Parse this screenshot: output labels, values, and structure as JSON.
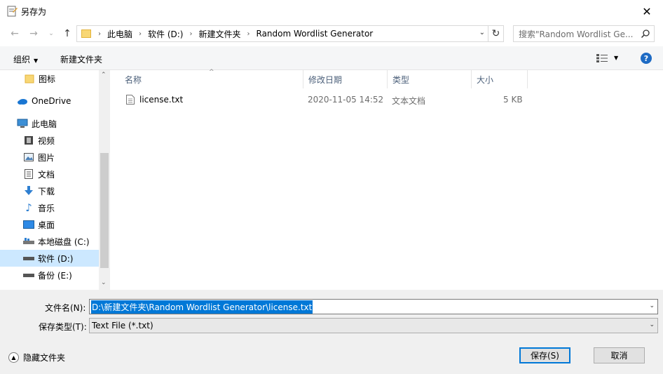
{
  "window": {
    "title": "另存为"
  },
  "address": {
    "crumbs": [
      "此电脑",
      "软件 (D:)",
      "新建文件夹",
      "Random Wordlist Generator"
    ]
  },
  "search": {
    "placeholder": "搜索\"Random Wordlist Ge..."
  },
  "toolbar": {
    "organize_label": "组织",
    "new_folder_label": "新建文件夹"
  },
  "nav": {
    "items": [
      {
        "label": "图标",
        "icon": "folder-icon"
      },
      {
        "label": "OneDrive",
        "icon": "cloud-icon"
      },
      {
        "label": "此电脑",
        "icon": "computer-icon"
      },
      {
        "label": "视频",
        "icon": "video-icon"
      },
      {
        "label": "图片",
        "icon": "picture-icon"
      },
      {
        "label": "文档",
        "icon": "document-icon"
      },
      {
        "label": "下载",
        "icon": "download-icon"
      },
      {
        "label": "音乐",
        "icon": "music-icon"
      },
      {
        "label": "桌面",
        "icon": "desktop-icon"
      },
      {
        "label": "本地磁盘 (C:)",
        "icon": "drive-icon"
      },
      {
        "label": "软件 (D:)",
        "icon": "drive-icon"
      },
      {
        "label": "备份 (E:)",
        "icon": "drive-icon"
      }
    ]
  },
  "filelist": {
    "columns": [
      "名称",
      "修改日期",
      "类型",
      "大小"
    ],
    "rows": [
      {
        "name": "license.txt",
        "modified": "2020-11-05 14:52",
        "type": "文本文档",
        "size": "5 KB"
      }
    ]
  },
  "form": {
    "filename_label": "文件名(N):",
    "filename_value": "D:\\新建文件夹\\Random Wordlist Generator\\license.txt",
    "filetype_label": "保存类型(T):",
    "filetype_value": "Text File (*.txt)",
    "hide_folders_label": "隐藏文件夹",
    "save_label": "保存(S)",
    "cancel_label": "取消"
  },
  "colors": {
    "accent": "#0078d7",
    "selected_bg": "#cce8ff",
    "header_text": "#4c607a"
  }
}
